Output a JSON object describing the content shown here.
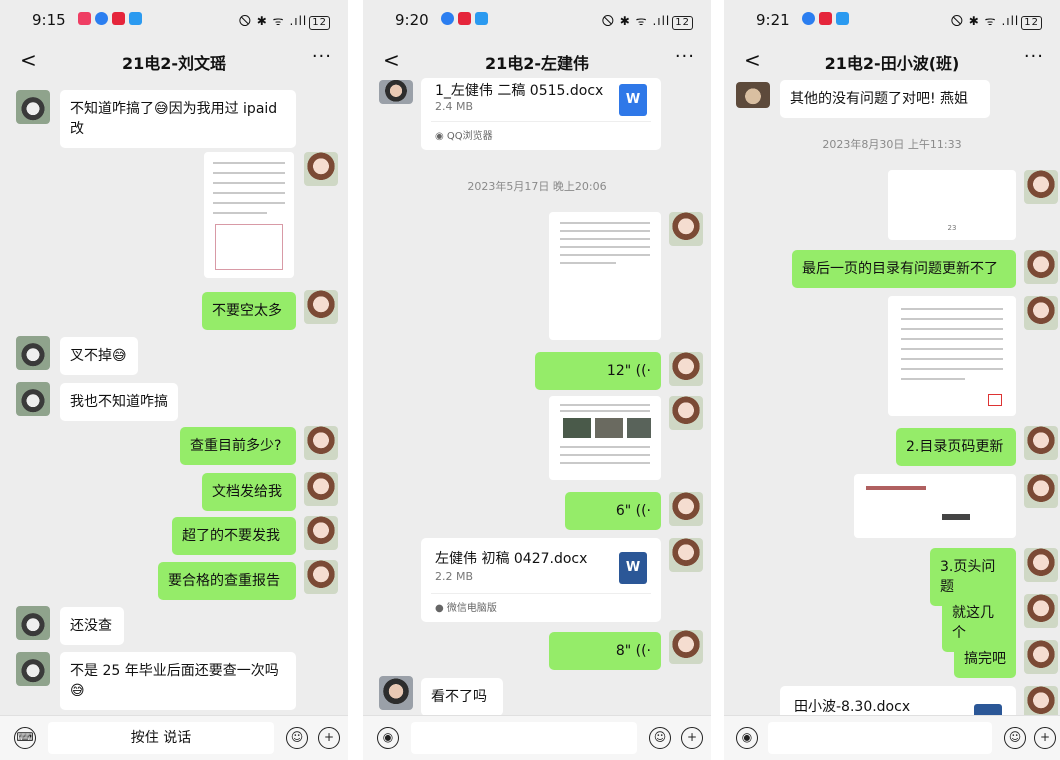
{
  "panel1": {
    "status_time": "9:15",
    "status_right": "🛇 ✱ ᯤ .ıll",
    "battery": "12",
    "title": "21电2-刘文瑶",
    "back": "<",
    "more": "···",
    "messages": {
      "m1": "不知道咋搞了😅因为我用过 ipaid 改",
      "m2": "不要空太多",
      "m3": "叉不掉😅",
      "m4": "我也不知道咋搞",
      "m5": "查重目前多少?",
      "m6": "文档发给我",
      "m7": "超了的不要发我",
      "m8": "要合格的查重报告",
      "m9": "还没查",
      "m10": "不是 25 年毕业后面还要查一次吗😅"
    },
    "input_label": "按住 说话"
  },
  "panel2": {
    "status_time": "9:20",
    "status_right": "🛇 ✱ ᯤ .ıll",
    "battery": "12",
    "title": "21电2-左建伟",
    "back": "<",
    "more": "···",
    "file1": {
      "name": "1_左健伟 二稿 0515.docx",
      "size": "2.4 MB",
      "source": "QQ浏览器"
    },
    "timestamp": "2023年5月17日 晚上20:06",
    "voice1": "12\" ((·",
    "voice2": "6\" ((·",
    "file2": {
      "name": "左健伟 初稿 0427.docx",
      "size": "2.2 MB",
      "source": "微信电脑版"
    },
    "voice3": "8\" ((·",
    "last_message": "看不了吗"
  },
  "panel3": {
    "status_time": "9:21",
    "status_right": "🛇 ✱ ᯤ .ıll",
    "battery": "12",
    "title": "21电2-田小波(班)",
    "back": "<",
    "more": "···",
    "m_top": "其他的没有问题了对吧! 燕姐",
    "timestamp": "2023年8月30日 上午11:33",
    "page_number": "23",
    "m1": "最后一页的目录有问题更新不了",
    "m2": "2.目录页码更新",
    "m3": "3.页头问题",
    "m4": "就这几个",
    "m5": "搞完吧",
    "file": {
      "name": "田小波-8.30.docx"
    }
  },
  "colors": {
    "bubble_green": "#95ec69",
    "chat_bg": "#ededed",
    "word_blue": "#2b5797"
  }
}
